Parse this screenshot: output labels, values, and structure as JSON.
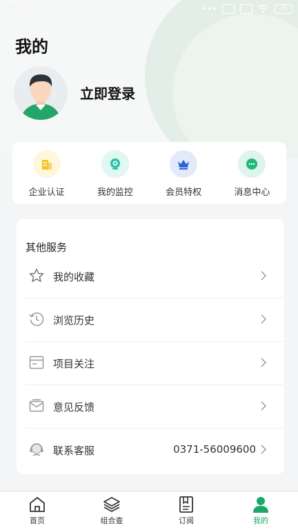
{
  "status_bar": {
    "time": "下午3:43",
    "battery": "75"
  },
  "page": {
    "title": "我的"
  },
  "profile": {
    "login_label": "立即登录"
  },
  "quick_actions": [
    {
      "label": "企业认证",
      "icon": "building-icon",
      "color": "#f3c326",
      "bg": "#fff6dc"
    },
    {
      "label": "我的监控",
      "icon": "camera-icon",
      "color": "#22c3a5",
      "bg": "#e0f7f2"
    },
    {
      "label": "会员特权",
      "icon": "crown-icon",
      "color": "#2c62d8",
      "bg": "#e3ebfb"
    },
    {
      "label": "消息中心",
      "icon": "chat-icon",
      "color": "#1fb77a",
      "bg": "#dff4ea"
    }
  ],
  "services": {
    "title": "其他服务",
    "items": [
      {
        "label": "我的收藏",
        "icon": "star-icon",
        "value": ""
      },
      {
        "label": "浏览历史",
        "icon": "history-icon",
        "value": ""
      },
      {
        "label": "项目关注",
        "icon": "project-icon",
        "value": ""
      },
      {
        "label": "意见反馈",
        "icon": "feedback-icon",
        "value": ""
      },
      {
        "label": "联系客服",
        "icon": "customer-service-icon",
        "value": "0371-56009600"
      }
    ]
  },
  "tabbar": {
    "active": "我的",
    "active_color": "#1aa866",
    "items": [
      {
        "label": "首页",
        "icon": "home-icon"
      },
      {
        "label": "组合查",
        "icon": "layers-icon"
      },
      {
        "label": "订阅",
        "icon": "subscribe-icon"
      },
      {
        "label": "我的",
        "icon": "profile-icon"
      }
    ]
  }
}
